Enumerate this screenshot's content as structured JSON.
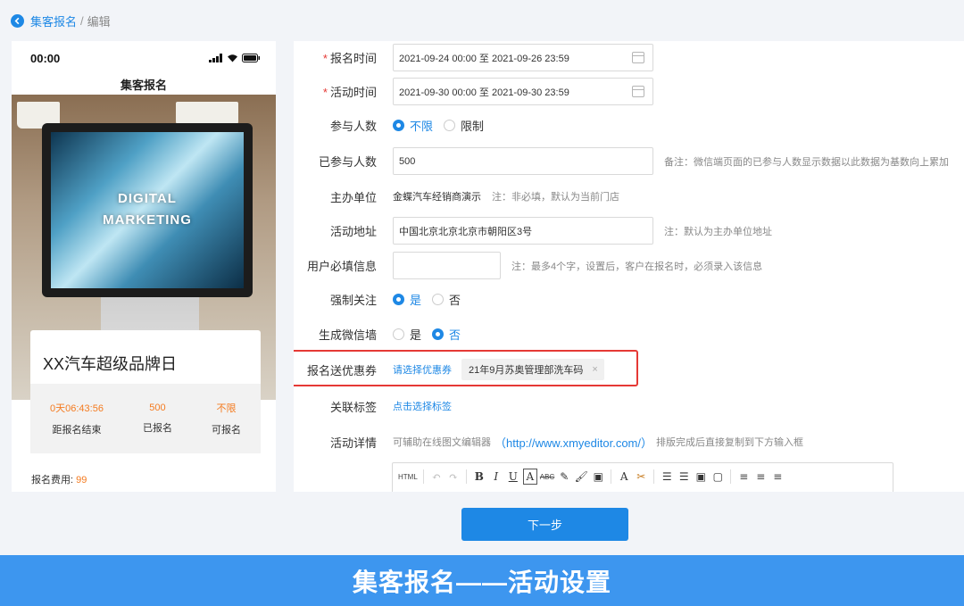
{
  "breadcrumb": {
    "link": "集客报名",
    "separator": "/",
    "current": "编辑"
  },
  "phone": {
    "time": "00:00",
    "title": "集客报名",
    "screen_text_1": "DIGITAL",
    "screen_text_2": "MARKETING",
    "event_title": "XX汽车超级品牌日",
    "stats": [
      {
        "value": "0天06:43:56",
        "label": "距报名结束"
      },
      {
        "value": "500",
        "label": "已报名"
      },
      {
        "value": "不限",
        "label": "可报名"
      }
    ],
    "fee_label": "报名费用:",
    "fee_value": "99"
  },
  "form": {
    "signup_time": {
      "label": "报名时间",
      "value": "2021-09-24 00:00 至 2021-09-26 23:59"
    },
    "activity_time": {
      "label": "活动时间",
      "value": "2021-09-30 00:00 至 2021-09-30 23:59"
    },
    "participants": {
      "label": "参与人数",
      "option_unlimited": "不限",
      "option_limit": "限制",
      "selected": "不限"
    },
    "joined_count": {
      "label": "已参与人数",
      "value": "500",
      "note": "备注：微信端页面的已参与人数显示数据以此数据为基数向上累加"
    },
    "organizer": {
      "label": "主办单位",
      "value": "金蝶汽车经销商演示",
      "note": "注：非必填，默认为当前门店"
    },
    "address": {
      "label": "活动地址",
      "value": "中国北京北京北京市朝阳区3号",
      "note": "注：默认为主办单位地址"
    },
    "required_info": {
      "label": "用户必填信息",
      "value": "",
      "note": "注：最多4个字，设置后，客户在报名时，必须录入该信息"
    },
    "force_follow": {
      "label": "强制关注",
      "option_yes": "是",
      "option_no": "否",
      "selected": "是"
    },
    "wechat_wall": {
      "label": "生成微信墙",
      "option_yes": "是",
      "option_no": "否",
      "selected": "否"
    },
    "coupon": {
      "label": "报名送优惠券",
      "select_link": "请选择优惠券",
      "tag": "21年9月苏奥管理部洗车码",
      "tag_close": "×"
    },
    "tags": {
      "label": "关联标签",
      "link": "点击选择标签"
    },
    "details": {
      "label": "活动详情",
      "text_before": "可辅助在线图文编辑器",
      "url": "（http://www.xmyeditor.com/）",
      "text_after": "排版完成后直接复制到下方输入框"
    },
    "required_mark": "*"
  },
  "editor_toolbar": [
    "HTML",
    "↶",
    "↷",
    "B",
    "I",
    "U",
    "A",
    "ABC",
    "✎",
    "🖌",
    "▣",
    "A",
    "✂",
    "☰",
    "☰",
    "▣",
    "▢",
    "≡",
    "≡",
    "≡"
  ],
  "next_button": "下一步",
  "banner": "集客报名——活动设置",
  "colors": {
    "accent": "#1e88e5",
    "orange": "#f47b20",
    "required": "#e53935",
    "banner": "#3d96ef"
  }
}
